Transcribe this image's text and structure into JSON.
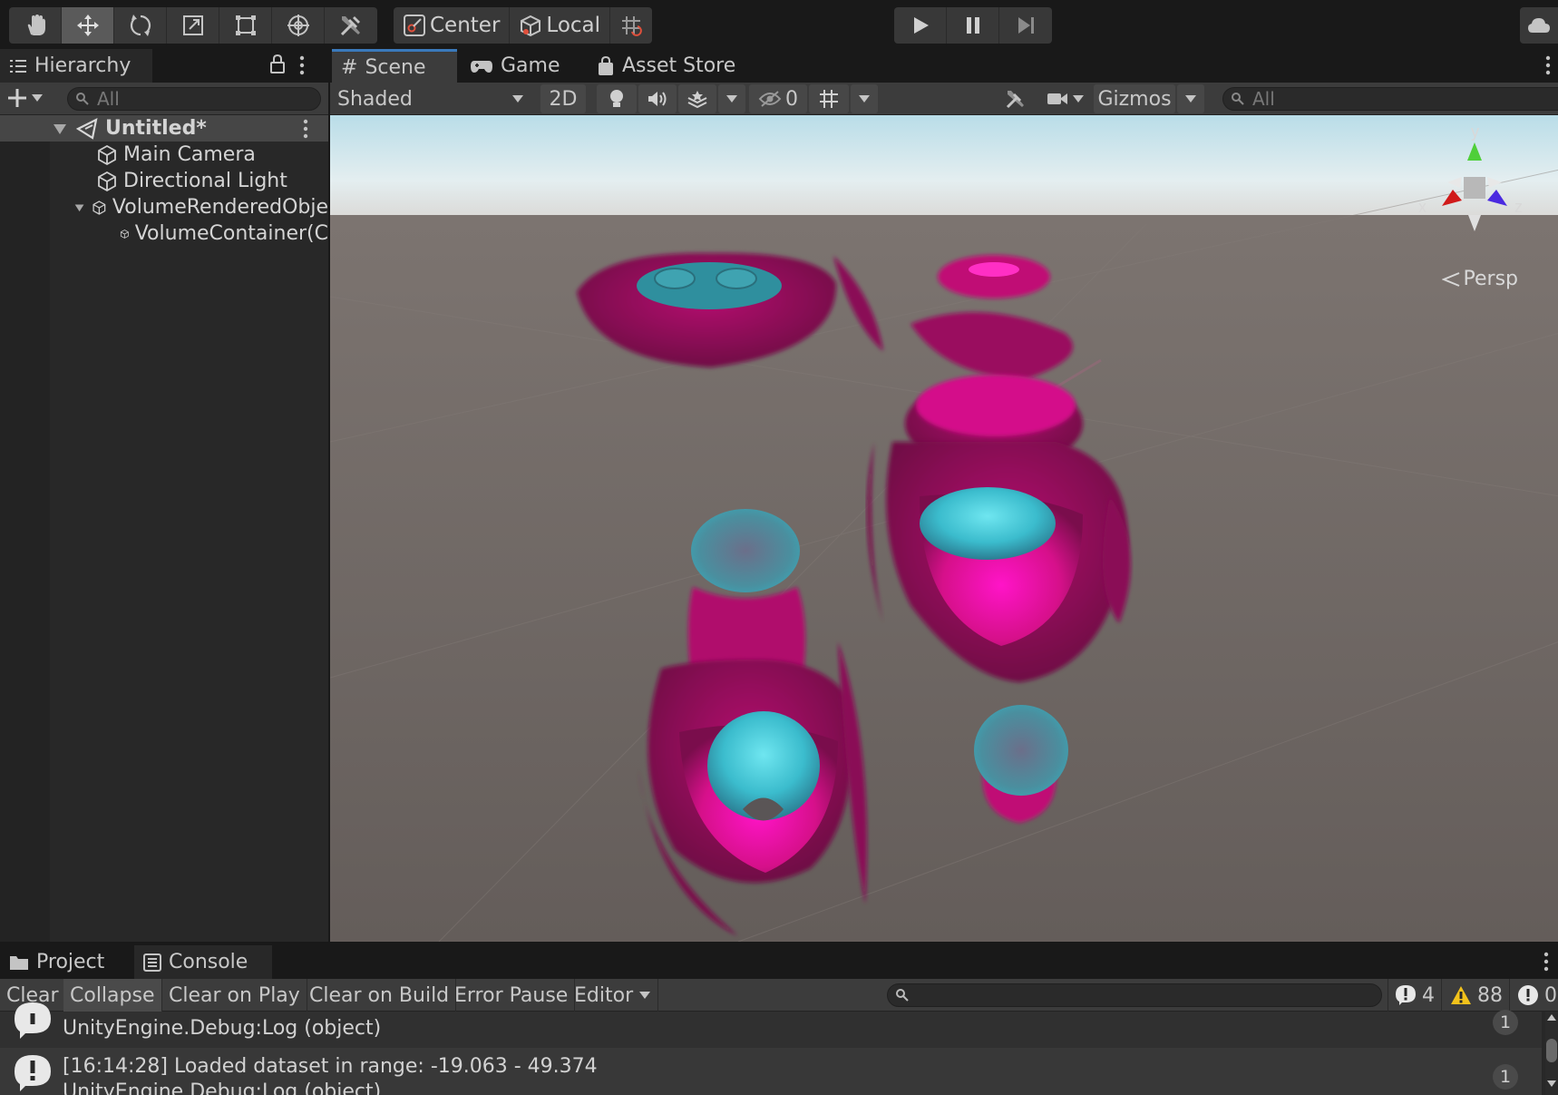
{
  "toolbar": {
    "tools": [
      "hand-tool",
      "move-tool",
      "rotate-tool",
      "scale-tool",
      "rect-tool",
      "transform-tool",
      "custom-tool"
    ],
    "pivot_label": "Center",
    "space_label": "Local"
  },
  "hierarchy": {
    "tab_label": "Hierarchy",
    "search_placeholder": "All",
    "scene_name": "Untitled*",
    "items": [
      {
        "label": "Main Camera"
      },
      {
        "label": "Directional Light"
      },
      {
        "label": "VolumeRenderedObje"
      },
      {
        "label": "VolumeContainer(C"
      }
    ]
  },
  "scene_tabs": [
    "Scene",
    "Game",
    "Asset Store"
  ],
  "scene_toolbar": {
    "shading_mode": "Shaded",
    "mode_2d": "2D",
    "hidden_count": "0",
    "gizmos_label": "Gizmos",
    "search_placeholder": "All"
  },
  "viewport": {
    "projection_label": "Persp",
    "axes": {
      "x": "x",
      "y": "y",
      "z": "z"
    },
    "colors": {
      "sky": "#dfeef2",
      "ground": "#6a625f",
      "magenta": "#d9127f",
      "teal": "#3ab8c9"
    }
  },
  "console": {
    "tabs": [
      "Project",
      "Console"
    ],
    "buttons": {
      "clear": "Clear",
      "collapse": "Collapse",
      "clear_on_play": "Clear on Play",
      "clear_on_build": "Clear on Build",
      "error_pause": "Error Pause",
      "editor": "Editor"
    },
    "counts": {
      "logs": "4",
      "warnings": "88",
      "errors": "0"
    },
    "entries": [
      {
        "line1": "",
        "line2": "UnityEngine.Debug:Log (object)",
        "count": "1"
      },
      {
        "line1": "[16:14:28] Loaded dataset in range: -19.063  -  49.374",
        "line2": "UnityEngine.Debug:Log (object)",
        "count": "1"
      }
    ]
  }
}
